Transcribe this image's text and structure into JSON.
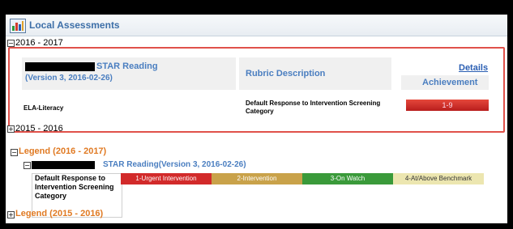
{
  "panel": {
    "title": "Local Assessments",
    "icon": "bar-chart-icon"
  },
  "years": [
    {
      "label": "2016 - 2017",
      "expanded": true
    },
    {
      "label": "2015 - 2016",
      "expanded": false
    }
  ],
  "assessment": {
    "name": "STAR Reading",
    "version": "(Version 3, 2016-02-26)",
    "rubric_header": "Rubric Description",
    "details_link": "Details",
    "achievement_header": "Achievement",
    "row_subject": "ELA-Literacy",
    "row_rubric": "Default Response to Intervention Screening Category",
    "row_score": "1-9",
    "score_color": "#d42c2c"
  },
  "legends": [
    {
      "label": "Legend (2016 - 2017)",
      "expanded": true
    },
    {
      "label": "Legend (2015 - 2016)",
      "expanded": false
    }
  ],
  "legend_detail": {
    "assessment_title": "STAR Reading(Version 3, 2016-02-26)",
    "category_label": "Default Response to Intervention Screening Category",
    "levels": [
      {
        "label": "1-Urgent Intervention",
        "color": "#d22a2a"
      },
      {
        "label": "2-Intervention",
        "color": "#c9a24a"
      },
      {
        "label": "3-On Watch",
        "color": "#3a9a3a"
      },
      {
        "label": "4-At/Above Benchmark",
        "color": "#ece6b0"
      }
    ]
  },
  "toggles": {
    "collapse": "−",
    "expand": "+"
  },
  "colors": {
    "accent": "#3d6fa8",
    "legend_orange": "#e07a23",
    "highlight_frame": "#e0514a"
  }
}
